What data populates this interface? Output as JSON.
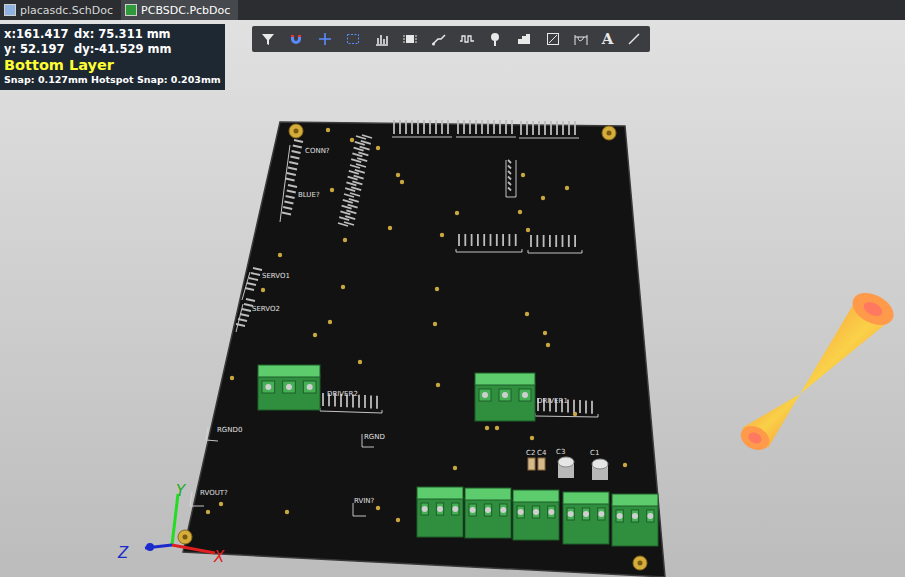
{
  "tabs": [
    {
      "label": "placasdc.SchDoc",
      "selected": false
    },
    {
      "label": "PCBSDC.PcbDoc",
      "selected": true
    }
  ],
  "hud": {
    "x": "x:161.417",
    "dx": "dx: 75.311 mm",
    "y": "y: 52.197",
    "dy": "dy:-41.529 mm",
    "layer": "Bottom Layer",
    "snap": "Snap: 0.127mm Hotspot Snap: 0.203mm"
  },
  "toolbar": {
    "text_tool": "A"
  },
  "board": {
    "labels": [
      "CONN?",
      "BLUE?",
      "SERVO1",
      "SERVO2",
      "DRIVER2",
      "DRIVER1",
      "RGND0",
      "RGND",
      "RVOUT?",
      "RVIN?",
      "C2",
      "C4",
      "C3",
      "C1"
    ]
  },
  "axes": [
    "Y",
    "Z",
    "X"
  ]
}
